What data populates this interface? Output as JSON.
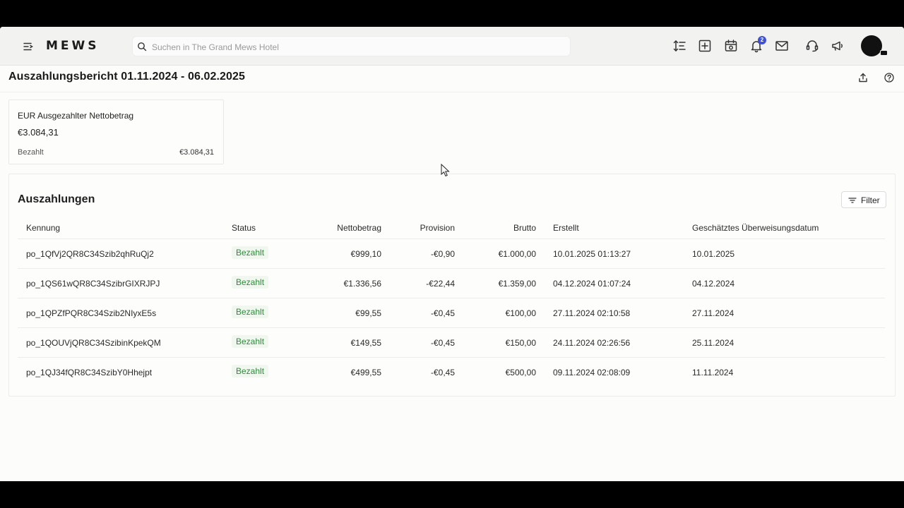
{
  "topbar": {
    "logo": "MEWS",
    "search_placeholder": "Suchen in The Grand Mews Hotel",
    "notifications_count": "2",
    "icons": [
      "menu-icon",
      "sort-icon",
      "add-icon",
      "calendar-icon",
      "bell-icon",
      "mail-icon",
      "headset-icon",
      "megaphone-icon"
    ]
  },
  "page": {
    "title": "Auszahlungsbericht 01.11.2024 - 06.02.2025"
  },
  "summary": {
    "title": "EUR Ausgezahlter Nettobetrag",
    "amount": "€3.084,31",
    "paid_label": "Bezahlt",
    "paid_value": "€3.084,31"
  },
  "payouts": {
    "title": "Auszahlungen",
    "filter_label": "Filter",
    "columns": {
      "id": "Kennung",
      "status": "Status",
      "net": "Nettobetrag",
      "fee": "Provision",
      "gross": "Brutto",
      "created": "Erstellt",
      "eta": "Geschätztes Überweisungsdatum"
    },
    "rows": [
      {
        "id": "po_1QfVj2QR8C34Szib2qhRuQj2",
        "status": "Bezahlt",
        "net": "€999,10",
        "fee": "-€0,90",
        "gross": "€1.000,00",
        "created": "10.01.2025 01:13:27",
        "eta": "10.01.2025"
      },
      {
        "id": "po_1QS61wQR8C34SzibrGIXRJPJ",
        "status": "Bezahlt",
        "net": "€1.336,56",
        "fee": "-€22,44",
        "gross": "€1.359,00",
        "created": "04.12.2024 01:07:24",
        "eta": "04.12.2024"
      },
      {
        "id": "po_1QPZfPQR8C34Szib2NIyxE5s",
        "status": "Bezahlt",
        "net": "€99,55",
        "fee": "-€0,45",
        "gross": "€100,00",
        "created": "27.11.2024 02:10:58",
        "eta": "27.11.2024"
      },
      {
        "id": "po_1QOUVjQR8C34SzibinKpekQM",
        "status": "Bezahlt",
        "net": "€149,55",
        "fee": "-€0,45",
        "gross": "€150,00",
        "created": "24.11.2024 02:26:56",
        "eta": "25.11.2024"
      },
      {
        "id": "po_1QJ34fQR8C34SzibY0Hhejpt",
        "status": "Bezahlt",
        "net": "€499,55",
        "fee": "-€0,45",
        "gross": "€500,00",
        "created": "09.11.2024 02:08:09",
        "eta": "11.11.2024"
      }
    ]
  },
  "colors": {
    "status_green": "#2e8b3a",
    "badge_blue": "#3f51d9"
  }
}
